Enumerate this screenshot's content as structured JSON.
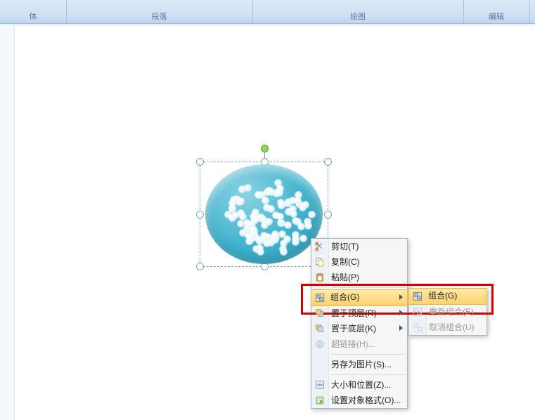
{
  "ribbon": {
    "groups": {
      "font": "体",
      "paragraph": "段落",
      "draw": "绘图",
      "edit": "编辑"
    }
  },
  "context_menu": {
    "cut": "剪切(T)",
    "copy": "复制(C)",
    "paste": "粘贴(P)",
    "group": "组合(G)",
    "bring_to_front": "置于顶层(R)",
    "send_to_back": "置于底层(K)",
    "hyperlink": "超链接(H)...",
    "save_as_picture": "另存为图片(S)...",
    "size_position": "大小和位置(Z)...",
    "format_object": "设置对象格式(O)..."
  },
  "group_submenu": {
    "group": "组合(G)",
    "regroup": "重新组合(E)",
    "ungroup": "取消组合(U)"
  },
  "icons": {
    "cut": "scissors-icon",
    "copy": "copy-icon",
    "paste": "clipboard-icon",
    "group": "group-icon",
    "front": "bring-front-icon",
    "back": "send-back-icon",
    "link": "hyperlink-icon",
    "size": "size-position-icon",
    "format": "format-object-icon",
    "regroup": "regroup-icon",
    "ungroup": "ungroup-icon"
  }
}
